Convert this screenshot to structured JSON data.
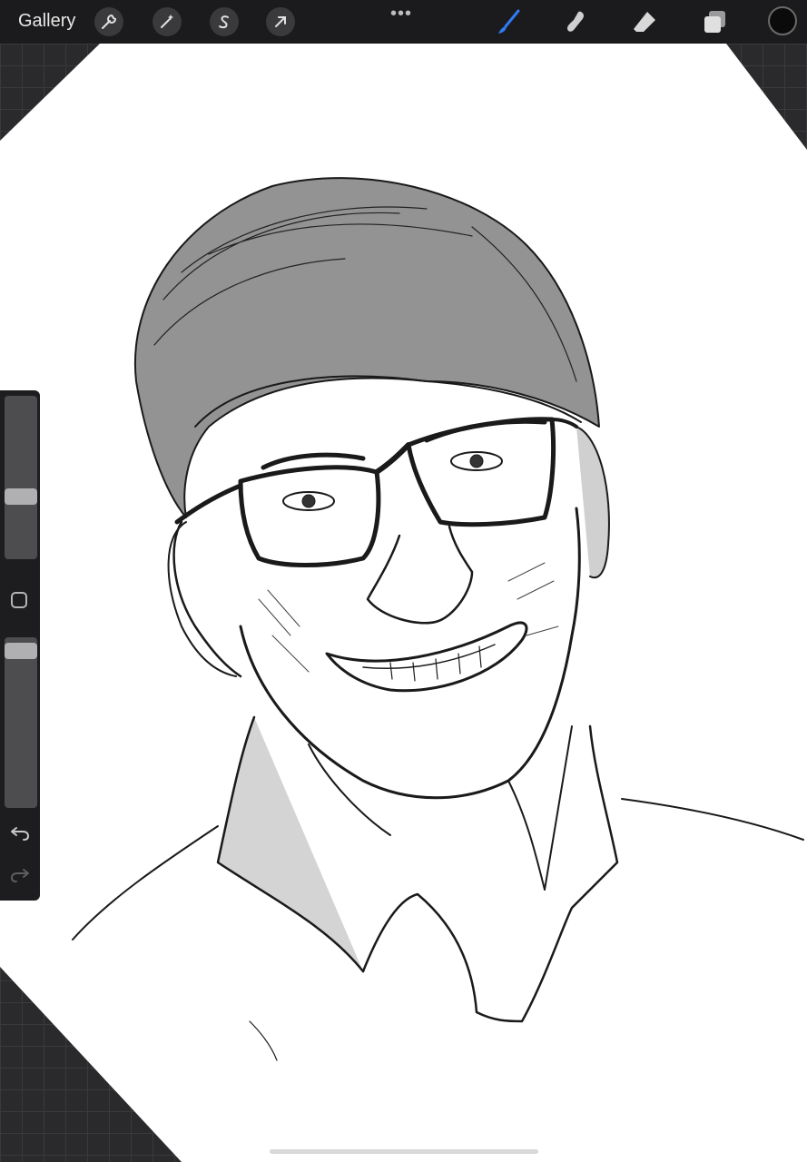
{
  "toolbar": {
    "gallery_label": "Gallery",
    "more_label": "•••",
    "actions": [
      "wrench-icon",
      "magic-wand-icon",
      "selection-s-icon",
      "transform-arrow-icon"
    ],
    "tools": [
      "brush-icon",
      "smudge-icon",
      "eraser-icon",
      "layers-icon"
    ],
    "active_tool": "brush",
    "active_tool_color": "#2f7bf5",
    "current_color": "#0b0b0b"
  },
  "sidebar": {
    "brush_size_level": 0.38,
    "opacity_level": 0.06
  },
  "colors": {
    "canvas": "#ffffff",
    "workspace": "#2a2a2c",
    "toolbar": "#1b1b1d"
  }
}
